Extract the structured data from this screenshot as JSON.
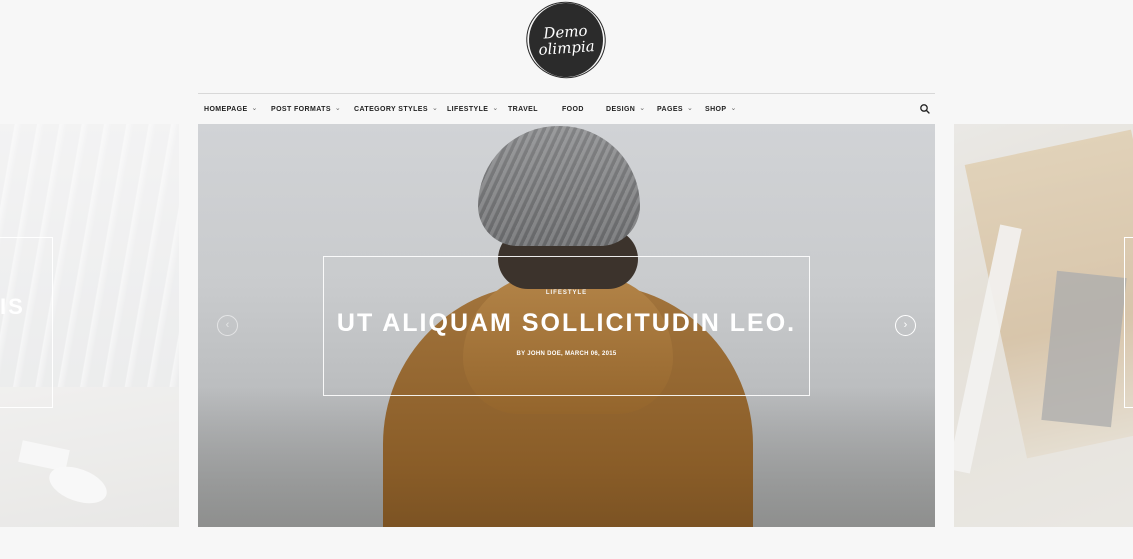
{
  "logo": {
    "line1": "Demo",
    "line2": "olimpia"
  },
  "nav": {
    "items": [
      {
        "label": "HOMEPAGE",
        "chevron": "⌄"
      },
      {
        "label": "POST FORMATS",
        "chevron": "⌄"
      },
      {
        "label": "CATEGORY STYLES",
        "chevron": "⌄"
      },
      {
        "label": "LIFESTYLE",
        "chevron": "⌄"
      },
      {
        "label": "TRAVEL",
        "chevron": ""
      },
      {
        "label": "FOOD",
        "chevron": ""
      },
      {
        "label": "DESIGN",
        "chevron": "⌄"
      },
      {
        "label": "PAGES",
        "chevron": "⌄"
      },
      {
        "label": "SHOP",
        "chevron": "⌄"
      }
    ],
    "search_icon": "search-icon"
  },
  "slider": {
    "left_slide": {
      "partial_title": "IS"
    },
    "main_slide": {
      "category": "LIFESTYLE",
      "title": "UT ALIQUAM SOLLICITUDIN LEO.",
      "meta": "BY JOHN DOE, MARCH 06, 2015"
    },
    "prev_arrow": "‹",
    "next_arrow": "›"
  },
  "colors": {
    "text": "#222222",
    "logo_bg": "#2b2b2b",
    "background": "#f7f7f7"
  }
}
